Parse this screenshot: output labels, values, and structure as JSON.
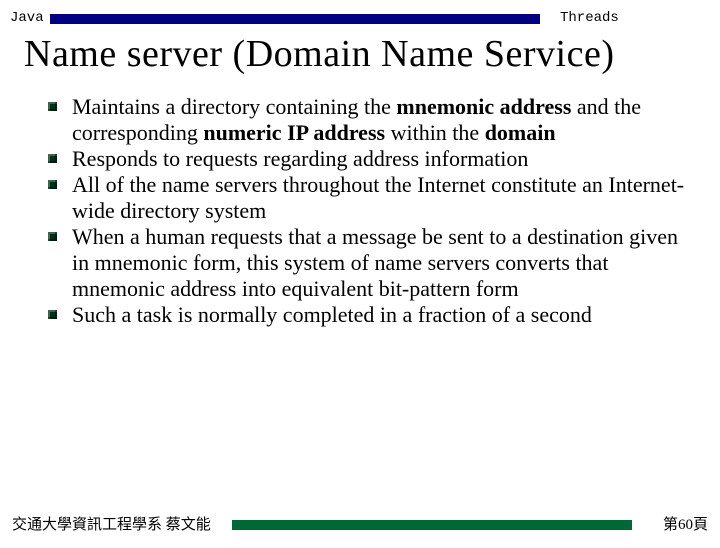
{
  "header": {
    "left": "Java",
    "right": "Threads"
  },
  "title": "Name server  (Domain Name Service)",
  "bullets": [
    "Maintains a directory containing the <b>mnemonic address</b> and the corresponding <b>numeric IP address</b> within the <b>domain</b>",
    "Responds to requests regarding address information",
    "All of the name servers throughout the Internet constitute an Internet-wide directory system",
    "When a human requests that a message be sent to a destination given in mnemonic form, this system of name servers converts that mnemonic address into equivalent bit-pattern form",
    "Such a task is normally completed in a fraction of a second"
  ],
  "footer": {
    "left": "交通大學資訊工程學系 蔡文能",
    "right": "第60頁"
  }
}
